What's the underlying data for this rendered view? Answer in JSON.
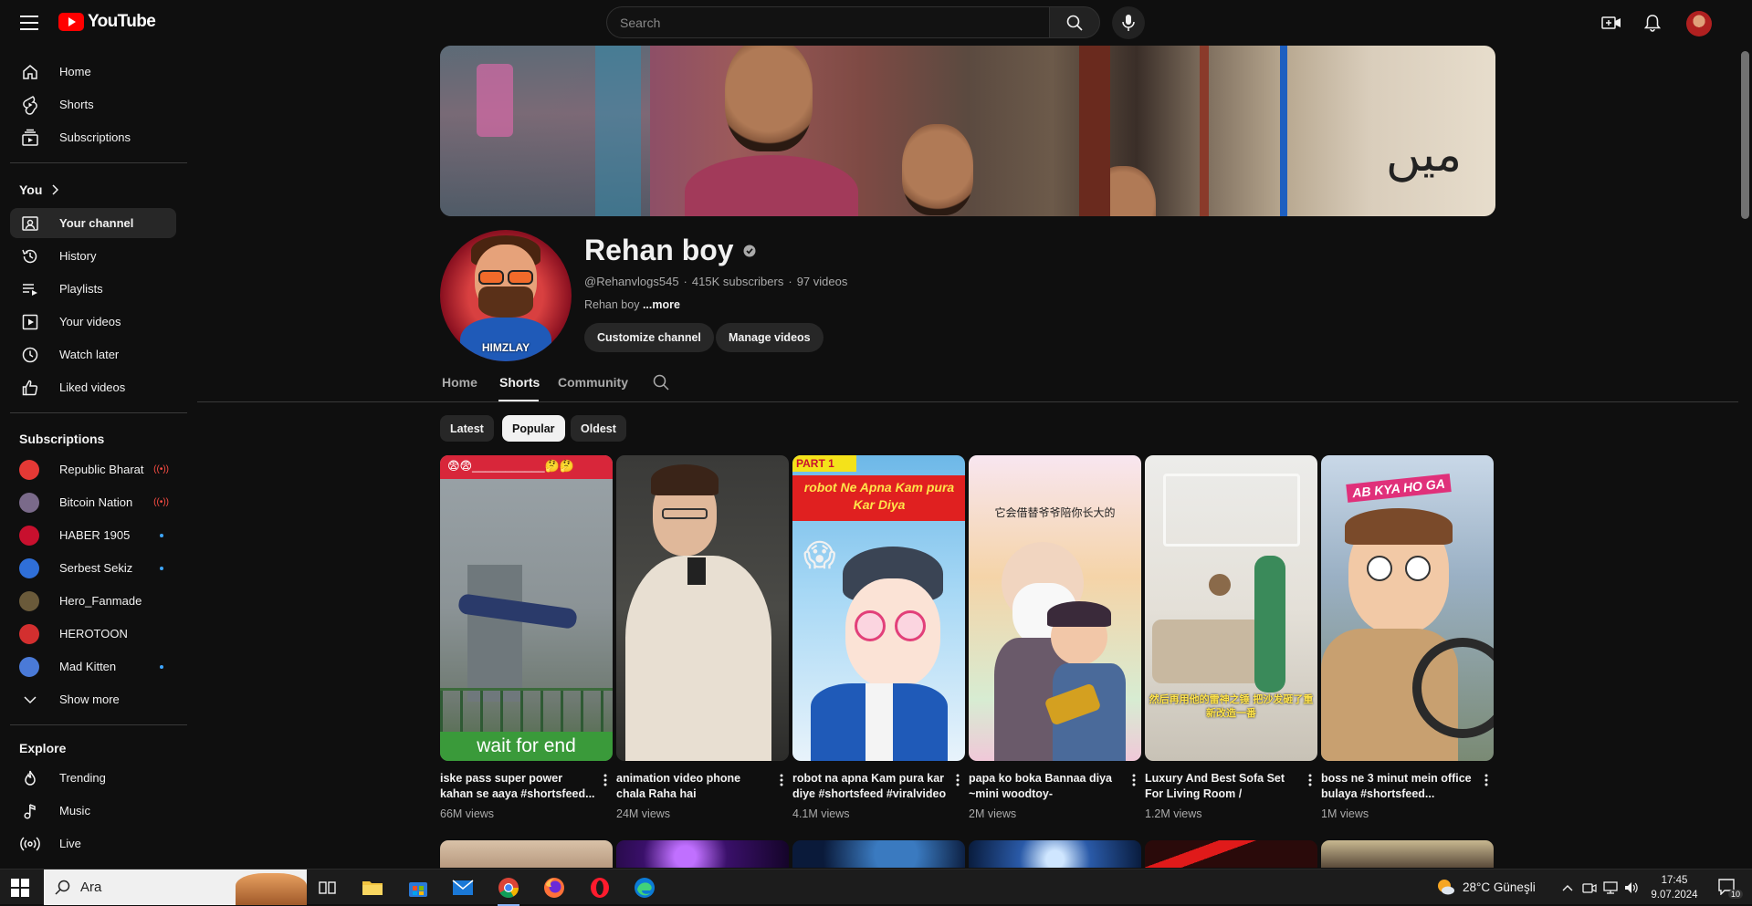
{
  "header": {
    "logo_text": "YouTube",
    "search_placeholder": "Search"
  },
  "sidebar": {
    "main": [
      {
        "label": "Home",
        "icon": "home-icon"
      },
      {
        "label": "Shorts",
        "icon": "shorts-icon"
      },
      {
        "label": "Subscriptions",
        "icon": "subscriptions-icon"
      }
    ],
    "you_heading": "You",
    "you_items": [
      {
        "label": "Your channel",
        "icon": "your-channel-icon",
        "active": true
      },
      {
        "label": "History",
        "icon": "history-icon"
      },
      {
        "label": "Playlists",
        "icon": "playlists-icon"
      },
      {
        "label": "Your videos",
        "icon": "your-videos-icon"
      },
      {
        "label": "Watch later",
        "icon": "watch-later-icon"
      },
      {
        "label": "Liked videos",
        "icon": "liked-videos-icon"
      }
    ],
    "subscriptions_heading": "Subscriptions",
    "subscriptions": [
      {
        "name": "Republic Bharat",
        "status": "live",
        "color": "#e53935"
      },
      {
        "name": "Bitcoin Nation",
        "status": "live",
        "color": "#7a6a8a"
      },
      {
        "name": "HABER 1905",
        "status": "new",
        "color": "#c8102e"
      },
      {
        "name": "Serbest Sekiz",
        "status": "new",
        "color": "#2f6fd8"
      },
      {
        "name": "Hero_Fanmade",
        "status": "",
        "color": "#6a5a3a"
      },
      {
        "name": "HEROTOON",
        "status": "",
        "color": "#d32f2f"
      },
      {
        "name": "Mad Kitten",
        "status": "new",
        "color": "#4a7ad8"
      }
    ],
    "show_more": "Show more",
    "explore_heading": "Explore",
    "explore": [
      {
        "label": "Trending",
        "icon": "trending-icon"
      },
      {
        "label": "Music",
        "icon": "music-icon"
      },
      {
        "label": "Live",
        "icon": "live-icon"
      }
    ]
  },
  "channel": {
    "name": "Rehan boy",
    "verified_icon": "verified-icon",
    "handle": "@Rehanvlogs545",
    "subscribers": "415K subscribers",
    "videos": "97 videos",
    "description": "Rehan boy",
    "more": "...more",
    "avatar_text": "HIMZLAY",
    "customize_label": "Customize channel",
    "manage_label": "Manage videos"
  },
  "tabs": [
    "Home",
    "Shorts",
    "Community"
  ],
  "active_tab": "Shorts",
  "chips": [
    "Latest",
    "Popular",
    "Oldest"
  ],
  "active_chip": "Popular",
  "shorts": [
    {
      "title": "iske pass super power kahan se aaya #shortsfeed...",
      "views": "66M views",
      "overlay": "wait for end",
      "top_caption": "😨😨___________🤔🤔"
    },
    {
      "title": "animation video phone chala Raha hai #shortsfeed...",
      "views": "24M views",
      "overlay": "",
      "top_caption": ""
    },
    {
      "title": "robot na apna Kam pura kar diye #shortsfeed #viralvideo",
      "views": "4.1M views",
      "overlay": "",
      "top_caption": "robot Ne Apna Kam pura Kar Diya",
      "badge": "PART 1"
    },
    {
      "title": "papa ko boka Bannaa diya ~mini woodtoy-woodworkin...",
      "views": "2M views",
      "overlay": "",
      "top_caption": "它会借替爷爷陪你长大的"
    },
    {
      "title": "Luxury And Best Sofa Set For Living Room / animation...",
      "views": "1.2M views",
      "overlay": "然后再用他的雷神之锤 把沙发砸了重新改造一番",
      "top_caption": ""
    },
    {
      "title": "boss ne 3 minut mein office bulaya #shortsfeed...",
      "views": "1M views",
      "overlay": "",
      "top_caption": "AB KYA HO GA"
    }
  ],
  "taskbar": {
    "search_text": "Ara",
    "weather": "28°C  Güneşli",
    "time": "17:45",
    "date": "9.07.2024",
    "notifications": "10"
  }
}
